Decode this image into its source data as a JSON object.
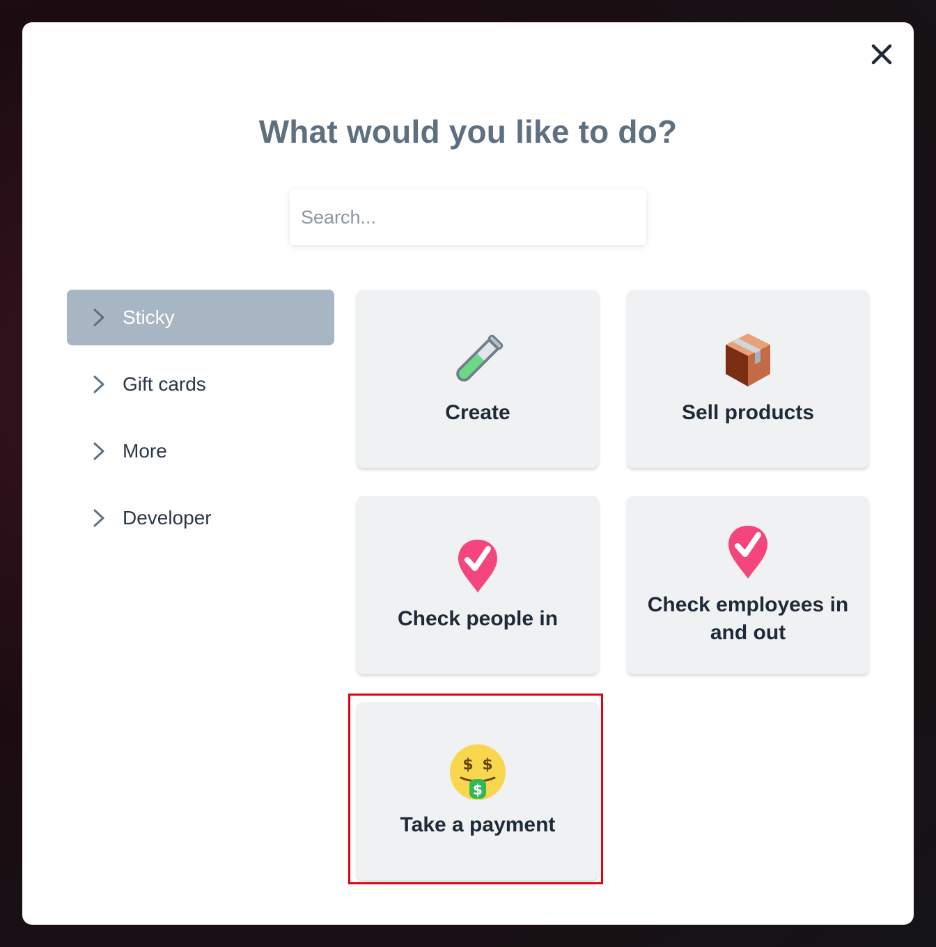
{
  "dialog": {
    "title": "What would you like to do?",
    "close_icon": "close-icon"
  },
  "search": {
    "placeholder": "Search..."
  },
  "sidebar": {
    "items": [
      {
        "label": "Sticky",
        "active": true,
        "icon": "chevron-right-icon"
      },
      {
        "label": "Gift cards",
        "active": false,
        "icon": "chevron-right-icon"
      },
      {
        "label": "More",
        "active": false,
        "icon": "chevron-right-icon"
      },
      {
        "label": "Developer",
        "active": false,
        "icon": "chevron-right-icon"
      }
    ]
  },
  "actions": [
    {
      "label": "Create",
      "icon": "test-tube-icon"
    },
    {
      "label": "Sell products",
      "icon": "package-box-icon"
    },
    {
      "label": "Check people in",
      "icon": "checkmark-pin-icon"
    },
    {
      "label": "Check employees in and out",
      "icon": "checkmark-pin-icon"
    },
    {
      "label": "Take a payment",
      "icon": "money-mouth-face-icon",
      "highlighted": true
    }
  ],
  "colors": {
    "title": "#5e7080",
    "sidebar_active_bg": "#a8b5c3",
    "card_bg": "#f0f1f3",
    "highlight_border": "#e3000f",
    "pin": "#f4457c"
  }
}
